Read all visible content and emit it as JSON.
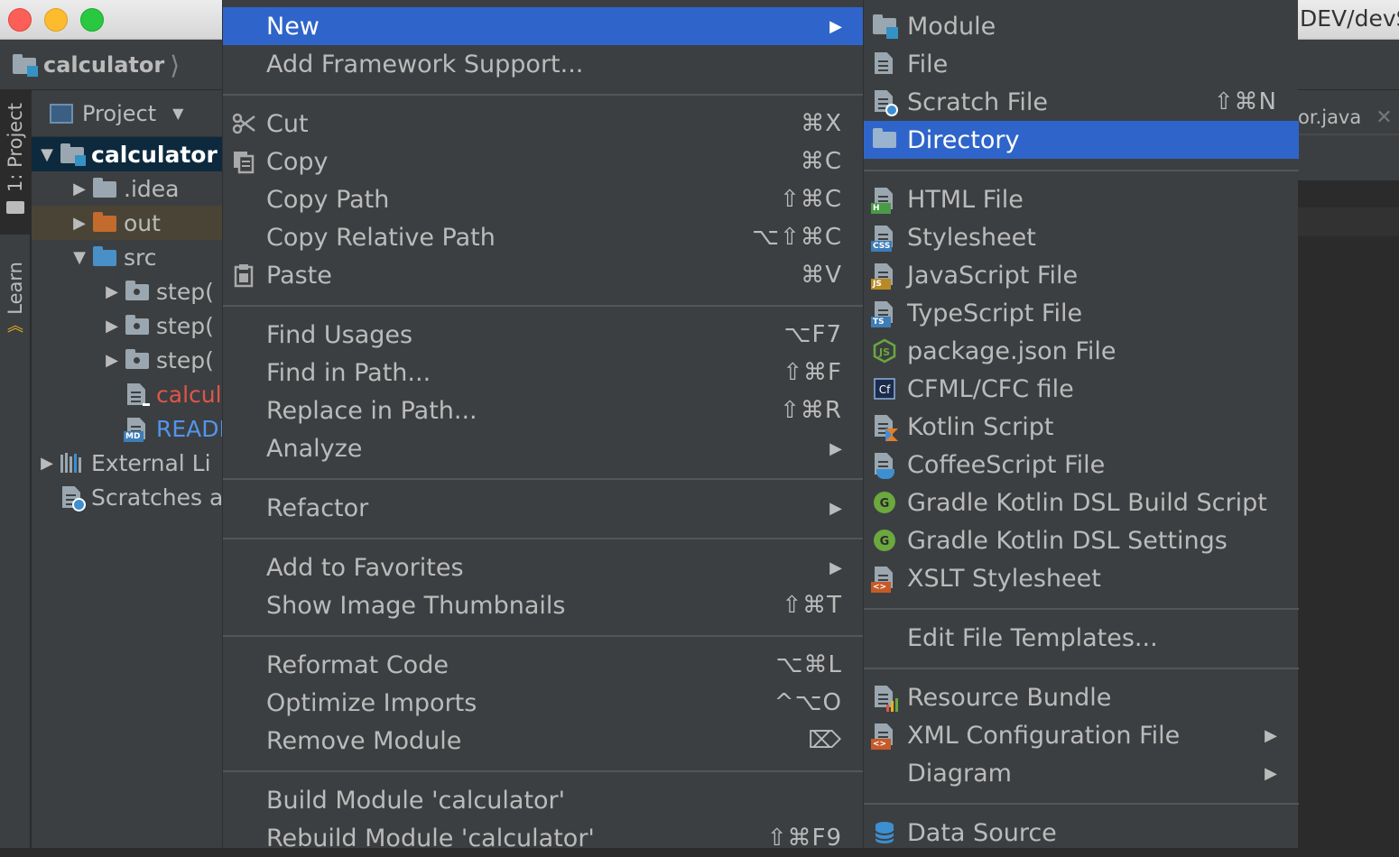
{
  "window": {
    "title_fragment": "DEV/devS"
  },
  "navbar": {
    "crumb": "calculator"
  },
  "toolstrip": {
    "project_tab": "1: Project",
    "learn_tab": "Learn"
  },
  "project": {
    "header": "Project",
    "tree": [
      {
        "label": "calculator",
        "level": 0,
        "arrow": "▼",
        "icon": "module",
        "color": "#ffffff",
        "bold": true
      },
      {
        "label": ".idea",
        "level": 1,
        "arrow": "▶",
        "icon": "folder",
        "color": "#bbbbbb"
      },
      {
        "label": "out",
        "level": 1,
        "arrow": "▶",
        "icon": "folder-orange",
        "color": "#bbbbbb"
      },
      {
        "label": "src",
        "level": 1,
        "arrow": "▼",
        "icon": "folder-blue",
        "color": "#bbbbbb"
      },
      {
        "label": "step(",
        "level": 2,
        "arrow": "▶",
        "icon": "package",
        "color": "#bbbbbb"
      },
      {
        "label": "step(",
        "level": 2,
        "arrow": "▶",
        "icon": "package",
        "color": "#bbbbbb"
      },
      {
        "label": "step(",
        "level": 2,
        "arrow": "▶",
        "icon": "package",
        "color": "#bbbbbb"
      },
      {
        "label": "calculat",
        "level": 2,
        "arrow": "",
        "icon": "file",
        "color": "#e0554a"
      },
      {
        "label": "READMI",
        "level": 2,
        "arrow": "",
        "icon": "md",
        "color": "#5394ec"
      },
      {
        "label": "External Li",
        "level": 0,
        "arrow": "▶",
        "icon": "libs",
        "color": "#bbbbbb"
      },
      {
        "label": "Scratches a",
        "level": 0,
        "arrow": "",
        "icon": "scratch",
        "color": "#bbbbbb"
      }
    ]
  },
  "editor": {
    "tab_label": "or.java"
  },
  "context_menu": {
    "items": [
      {
        "label": "New",
        "shortcut": "",
        "submenu": true,
        "selected": true,
        "icon": ""
      },
      {
        "label": "Add Framework Support...",
        "shortcut": "",
        "icon": ""
      },
      {
        "sep": true
      },
      {
        "label": "Cut",
        "shortcut": "⌘X",
        "icon": "scissors-icon"
      },
      {
        "label": "Copy",
        "shortcut": "⌘C",
        "icon": "copy-icon"
      },
      {
        "label": "Copy Path",
        "shortcut": "⇧⌘C",
        "icon": ""
      },
      {
        "label": "Copy Relative Path",
        "shortcut": "⌥⇧⌘C",
        "icon": ""
      },
      {
        "label": "Paste",
        "shortcut": "⌘V",
        "icon": "clipboard-icon"
      },
      {
        "sep": true
      },
      {
        "label": "Find Usages",
        "shortcut": "⌥F7",
        "icon": ""
      },
      {
        "label": "Find in Path...",
        "shortcut": "⇧⌘F",
        "icon": ""
      },
      {
        "label": "Replace in Path...",
        "shortcut": "⇧⌘R",
        "icon": ""
      },
      {
        "label": "Analyze",
        "shortcut": "",
        "submenu": true,
        "icon": ""
      },
      {
        "sep": true
      },
      {
        "label": "Refactor",
        "shortcut": "",
        "submenu": true,
        "icon": ""
      },
      {
        "sep": true
      },
      {
        "label": "Add to Favorites",
        "shortcut": "",
        "submenu": true,
        "icon": ""
      },
      {
        "label": "Show Image Thumbnails",
        "shortcut": "⇧⌘T",
        "icon": ""
      },
      {
        "sep": true
      },
      {
        "label": "Reformat Code",
        "shortcut": "⌥⌘L",
        "icon": ""
      },
      {
        "label": "Optimize Imports",
        "shortcut": "^⌥O",
        "icon": ""
      },
      {
        "label": "Remove Module",
        "shortcut": "⌦",
        "icon": ""
      },
      {
        "sep": true
      },
      {
        "label": "Build Module 'calculator'",
        "shortcut": "",
        "icon": ""
      },
      {
        "label": "Rebuild Module 'calculator'",
        "shortcut": "⇧⌘F9",
        "icon": ""
      }
    ]
  },
  "new_submenu": {
    "items": [
      {
        "label": "Module",
        "shortcut": "",
        "icon": "module-icon"
      },
      {
        "label": "File",
        "shortcut": "",
        "icon": "file-icon"
      },
      {
        "label": "Scratch File",
        "shortcut": "⇧⌘N",
        "icon": "scratch-file-icon"
      },
      {
        "label": "Directory",
        "shortcut": "",
        "icon": "folder-icon",
        "selected": true
      },
      {
        "sep": true
      },
      {
        "label": "HTML File",
        "shortcut": "",
        "icon": "html-file-icon",
        "badge": "H",
        "badge_color": "#4a9a48"
      },
      {
        "label": "Stylesheet",
        "shortcut": "",
        "icon": "css-file-icon",
        "badge": "CSS",
        "badge_color": "#3d7db8"
      },
      {
        "label": "JavaScript File",
        "shortcut": "",
        "icon": "js-file-icon",
        "badge": "JS",
        "badge_color": "#b88a25"
      },
      {
        "label": "TypeScript File",
        "shortcut": "",
        "icon": "ts-file-icon",
        "badge": "TS",
        "badge_color": "#3d7db8"
      },
      {
        "label": "package.json File",
        "shortcut": "",
        "icon": "nodejs-icon"
      },
      {
        "label": "CFML/CFC file",
        "shortcut": "",
        "icon": "cfml-icon"
      },
      {
        "label": "Kotlin Script",
        "shortcut": "",
        "icon": "kotlin-file-icon"
      },
      {
        "label": "CoffeeScript File",
        "shortcut": "",
        "icon": "coffeescript-icon"
      },
      {
        "label": "Gradle Kotlin DSL Build Script",
        "shortcut": "",
        "icon": "gradle-icon"
      },
      {
        "label": "Gradle Kotlin DSL Settings",
        "shortcut": "",
        "icon": "gradle-icon"
      },
      {
        "label": "XSLT Stylesheet",
        "shortcut": "",
        "icon": "xslt-file-icon",
        "badge": "<>",
        "badge_color": "#c75a28"
      },
      {
        "sep": true
      },
      {
        "label": "Edit File Templates...",
        "shortcut": "",
        "icon": ""
      },
      {
        "sep": true
      },
      {
        "label": "Resource Bundle",
        "shortcut": "",
        "icon": "resource-bundle-icon"
      },
      {
        "label": "XML Configuration File",
        "shortcut": "",
        "submenu": true,
        "icon": "xml-file-icon",
        "badge": "<>",
        "badge_color": "#c75a28"
      },
      {
        "label": "Diagram",
        "shortcut": "",
        "submenu": true,
        "icon": ""
      },
      {
        "sep": true
      },
      {
        "label": "Data Source",
        "shortcut": "",
        "icon": "database-icon"
      }
    ]
  }
}
